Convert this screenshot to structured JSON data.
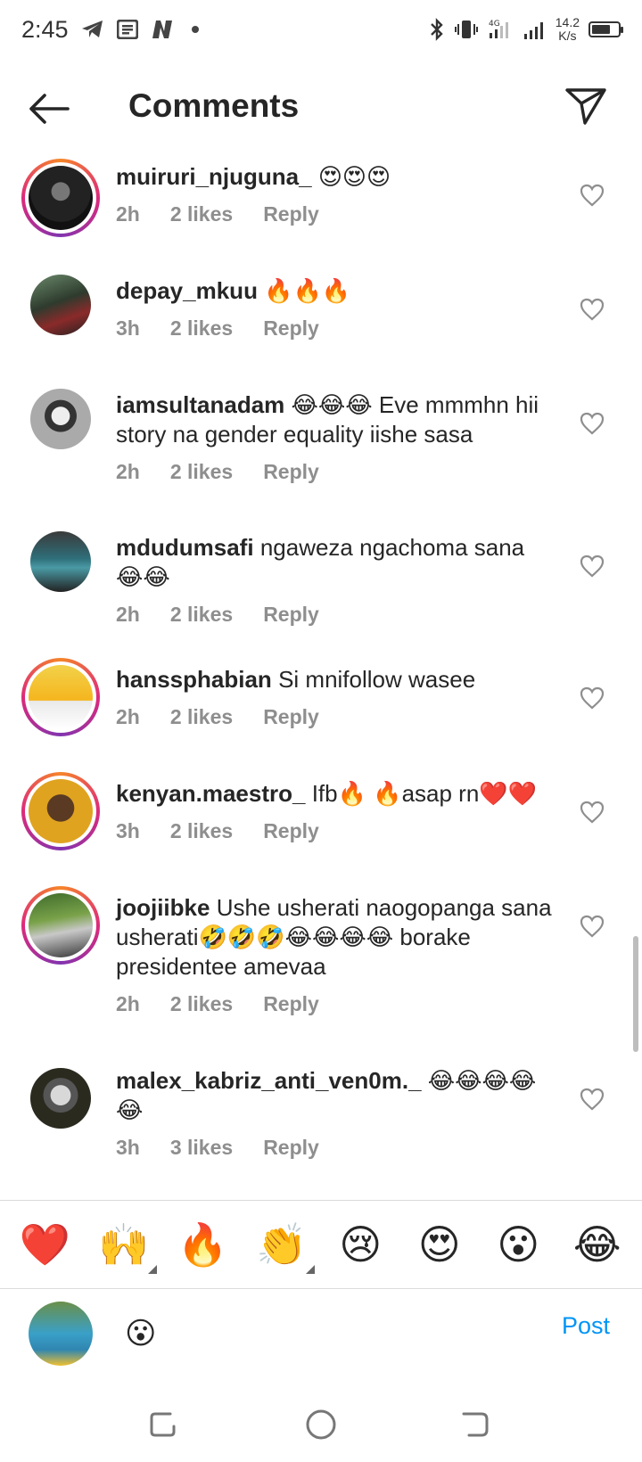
{
  "status_bar": {
    "time": "2:45",
    "network_speed_value": "14.2",
    "network_speed_unit": "K/s",
    "network_type": "4G",
    "battery_level": 0.7
  },
  "header": {
    "title": "Comments"
  },
  "comments": [
    {
      "username": "muiruri_njuguna_",
      "text": "😍😍😍",
      "time": "2h",
      "likes": "2 likes",
      "reply": "Reply"
    },
    {
      "username": "depay_mkuu",
      "text": "🔥🔥🔥",
      "time": "3h",
      "likes": "2 likes",
      "reply": "Reply"
    },
    {
      "username": "iamsultanadam",
      "text": "😂😂😂 Eve mmmhn hii story na gender equality iishe sasa",
      "time": "2h",
      "likes": "2 likes",
      "reply": "Reply"
    },
    {
      "username": "mdudumsafi",
      "text": "ngaweza ngachoma sana 😂😂",
      "time": "2h",
      "likes": "2 likes",
      "reply": "Reply"
    },
    {
      "username": "hanssphabian",
      "text": "Si mnifollow wasee",
      "time": "2h",
      "likes": "2 likes",
      "reply": "Reply"
    },
    {
      "username": "kenyan.maestro_",
      "text": "Ifb🔥 🔥asap rn❤️❤️",
      "time": "3h",
      "likes": "2 likes",
      "reply": "Reply"
    },
    {
      "username": "joojiibke",
      "text": "Ushe usherati naogopanga sana usherati🤣🤣🤣😂😂😂😂 borake presidentee amevaa",
      "time": "2h",
      "likes": "2 likes",
      "reply": "Reply"
    },
    {
      "username": "malex_kabriz_anti_ven0m._",
      "text": "😂😂😂😂😂",
      "time": "3h",
      "likes": "3 likes",
      "reply": "Reply"
    }
  ],
  "emoji_bar": [
    "❤️",
    "🙌",
    "🔥",
    "👏",
    "😢",
    "😍",
    "😮",
    "😂"
  ],
  "composer": {
    "value": "😮",
    "post_label": "Post"
  },
  "colors": {
    "accent": "#0095f6",
    "meta_text": "#8e8e8e",
    "primary_text": "#262626"
  }
}
